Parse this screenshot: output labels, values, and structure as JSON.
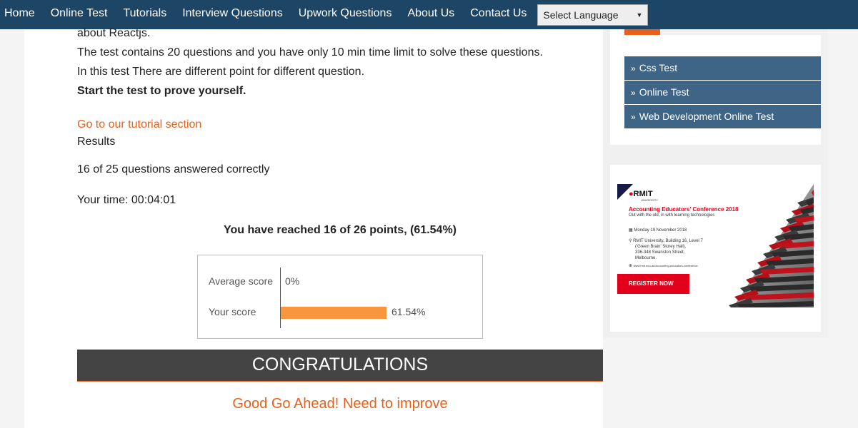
{
  "nav": {
    "items": [
      "Home",
      "Online Test",
      "Tutorials",
      "Interview Questions",
      "Upwork Questions",
      "About Us",
      "Contact Us"
    ],
    "language_select": "Select Language"
  },
  "content": {
    "intro_tail": "about Reactjs.",
    "line1": "The test contains 20 questions and you have only 10 min time limit to solve these questions.",
    "line2": "In this test There are different point for different question.",
    "line3": "Start the test to prove yourself.",
    "tutorial_link": "Go to our tutorial section",
    "results_label": "Results",
    "answered": "16 of 25 questions answered correctly",
    "time": "Your time: 00:04:01",
    "points": "You have reached 16 of 26 points, (61.54%)"
  },
  "score_chart": {
    "rows": [
      {
        "label": "Average score",
        "value": 0,
        "display": "0%"
      },
      {
        "label": "Your score",
        "value": 61.54,
        "display": "61.54%"
      }
    ],
    "bar_color": "#f7963f"
  },
  "congrats": {
    "title": "CONGRATULATIONS",
    "message": "Good Go Ahead! Need to improve"
  },
  "sidebar": {
    "links": [
      "Css Test",
      "Online Test",
      "Web Development Online Test"
    ],
    "ad": {
      "logo": "RMIT",
      "logo_sub": "UNIVERSITY",
      "headline": "Accounting Educators' Conference 2018",
      "tagline": "Out with the old, in with learning technologies",
      "date": "Monday 19 November 2018",
      "location_lines": [
        "RMIT University, Building 16, Level 7",
        "('Green Brain' Storey Hall),",
        "336-348 Swanston Street,",
        "Melbourne."
      ],
      "website": "www.rmit.edu.au/accounting-educators-conference",
      "button": "REGISTER NOW"
    }
  },
  "colors": {
    "nav_bg": "#1c4566",
    "accent": "#e8601c",
    "side_link_bg": "#3e6585",
    "banner_bg": "#444444"
  }
}
